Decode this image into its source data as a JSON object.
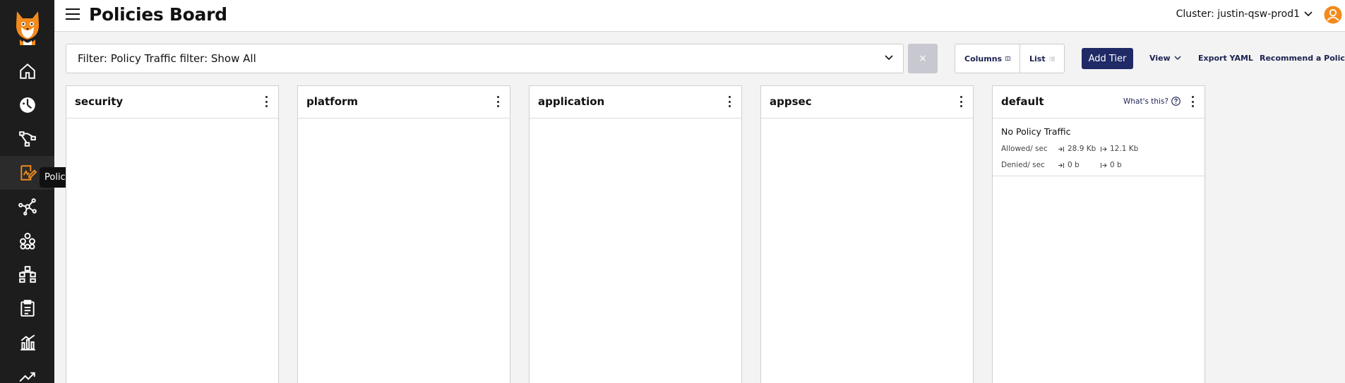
{
  "sidebar": {
    "tooltip": "Policies",
    "items": [
      {
        "icon": "home-icon"
      },
      {
        "icon": "dashboard-icon"
      },
      {
        "icon": "service-graph-icon"
      },
      {
        "icon": "policies-icon",
        "active": true
      },
      {
        "icon": "network-icon"
      },
      {
        "icon": "endpoints-icon"
      },
      {
        "icon": "namespaces-icon"
      },
      {
        "icon": "compliance-icon"
      },
      {
        "icon": "statistics-icon"
      },
      {
        "icon": "activity-icon"
      }
    ],
    "accent": "#f28a1c"
  },
  "header": {
    "title": "Policies Board",
    "cluster": "Cluster: justin-qsw-prod1"
  },
  "toolbar": {
    "filter": "Filter: Policy Traffic filter: Show All",
    "clear": "×",
    "columns_label": "Columns",
    "list_label": "List",
    "add_tier_label": "Add Tier",
    "view_label": "View",
    "export_label": "Export YAML",
    "recommend_label": "Recommend a Policy"
  },
  "tiers": [
    {
      "name": "security"
    },
    {
      "name": "platform"
    },
    {
      "name": "application"
    },
    {
      "name": "appsec"
    },
    {
      "name": "default",
      "whats_this": "What's this?",
      "policy": {
        "name": "No Policy Traffic",
        "allowed_label": "Allowed/ sec",
        "allowed_in": "28.9 Kb",
        "allowed_out": "12.1 Kb",
        "denied_label": "Denied/ sec",
        "denied_in": "0 b",
        "denied_out": "0 b"
      }
    }
  ],
  "colors": {
    "primary": "#1f2a66",
    "sidebar": "#1d1d1d",
    "accent": "#f28a1c"
  }
}
